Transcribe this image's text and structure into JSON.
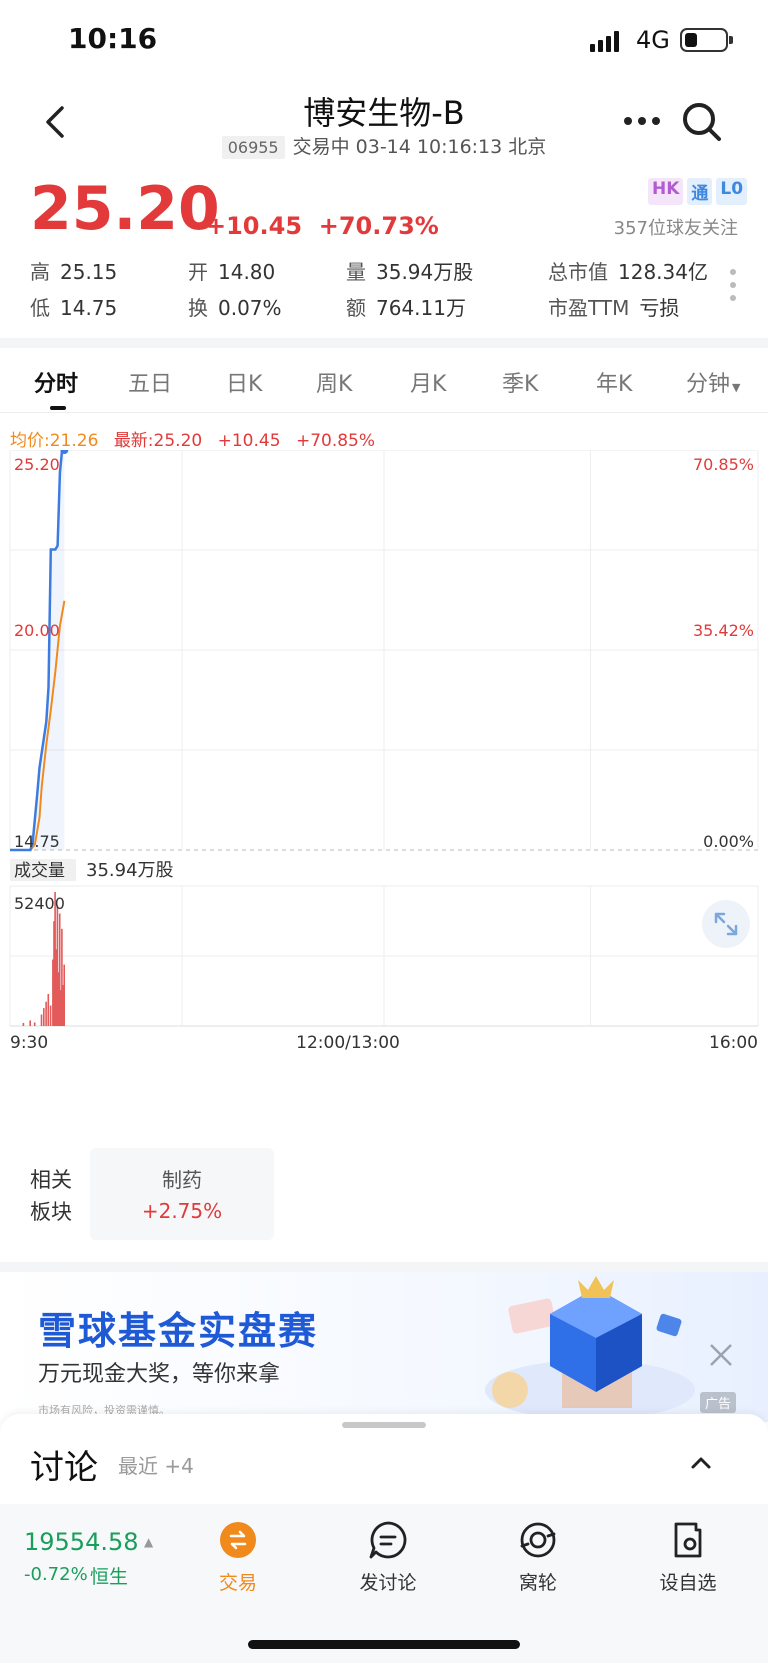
{
  "status_bar": {
    "time": "10:16",
    "network": "4G"
  },
  "header": {
    "stock_name": "博安生物-B",
    "code": "06955",
    "status_line": "交易中 03-14 10:16:13 北京"
  },
  "quote": {
    "price": "25.20",
    "change": "+10.45",
    "change_pct": "+70.73%",
    "badges": [
      "HK",
      "通",
      "L0"
    ],
    "followers": "357位球友关注",
    "stats": {
      "high_label": "高",
      "high": "25.15",
      "low_label": "低",
      "low": "14.75",
      "open_label": "开",
      "open": "14.80",
      "turnover_label": "换",
      "turnover": "0.07%",
      "volume_label": "量",
      "volume": "35.94万股",
      "amount_label": "额",
      "amount": "764.11万",
      "mcap_label": "总市值",
      "mcap": "128.34亿",
      "pe_label": "市盈TTM",
      "pe": "亏损"
    }
  },
  "tabs": [
    "分时",
    "五日",
    "日K",
    "周K",
    "月K",
    "季K",
    "年K",
    "分钟"
  ],
  "active_tab": "分时",
  "info_line": {
    "avg": "均价:21.26",
    "latest": "最新:25.20",
    "change": "+10.45",
    "change_pct": "+70.85%"
  },
  "volume_panel": {
    "label": "成交量",
    "value": "35.94万股"
  },
  "chart_data": {
    "type": "line",
    "title": "",
    "xlabel": "",
    "ylabel": "",
    "y_left_ticks": [
      "25.20",
      "20.00",
      "14.75"
    ],
    "y_right_ticks": [
      "70.85%",
      "35.42%",
      "0.00%"
    ],
    "x_ticks": [
      "9:30",
      "12:00/13:00",
      "16:00"
    ],
    "ylim": [
      14.75,
      25.2
    ],
    "grid": true,
    "series": [
      {
        "color": "#3d7be0",
        "x": [
          0,
          9,
          10,
          12,
          13,
          16,
          17,
          18,
          19,
          20,
          21,
          22,
          23,
          24
        ],
        "values": [
          14.75,
          14.75,
          14.95,
          16.2,
          16.9,
          18.1,
          19.0,
          22.6,
          22.6,
          22.6,
          22.7,
          24.6,
          25.2,
          25.2
        ]
      },
      {
        "color": "#f08a1c",
        "x": [
          0,
          9,
          11,
          13,
          14,
          16,
          18,
          20,
          22,
          24
        ],
        "values": [
          14.75,
          14.75,
          14.9,
          15.6,
          16.4,
          17.5,
          18.4,
          19.4,
          20.6,
          21.26
        ]
      }
    ],
    "volume": {
      "ymax_label": "52400",
      "ymax": 52400,
      "color": "#e25a5a",
      "x": [
        6,
        9,
        11,
        14,
        15,
        16,
        17,
        18,
        19,
        19.5,
        20,
        20.5,
        21,
        21.5,
        22,
        22.5,
        23,
        23.5,
        24
      ],
      "values": [
        1200,
        2200,
        1400,
        4500,
        7000,
        9500,
        12500,
        8000,
        26000,
        41000,
        52400,
        30000,
        47000,
        21000,
        44000,
        14000,
        38000,
        16000,
        24000
      ]
    }
  },
  "related": {
    "label": "相关板块",
    "sector": "制药",
    "sector_change": "+2.75%"
  },
  "ad": {
    "title": "雪球基金实盘赛",
    "subtitle": "万元现金大奖，等你来拿",
    "disclaimer": "市场有风险，投资需谨慎。",
    "tag": "广告"
  },
  "discussion": {
    "title": "讨论",
    "recent": "最近 +4"
  },
  "index": {
    "value": "19554.58",
    "change": "-0.72%",
    "name": "恒生"
  },
  "bottom_nav": [
    {
      "label": "交易",
      "icon": "trade-icon",
      "active": true
    },
    {
      "label": "发讨论",
      "icon": "post-discussion-icon",
      "active": false
    },
    {
      "label": "窝轮",
      "icon": "warrant-icon",
      "active": false
    },
    {
      "label": "设自选",
      "icon": "add-watchlist-icon",
      "active": false
    }
  ],
  "colors": {
    "up": "#e23a3a",
    "down": "#1a9e5b",
    "price_line": "#3d7be0",
    "avg_line": "#f08a1c",
    "accent": "#f08a1c",
    "ad_title": "#1f5ad6"
  }
}
